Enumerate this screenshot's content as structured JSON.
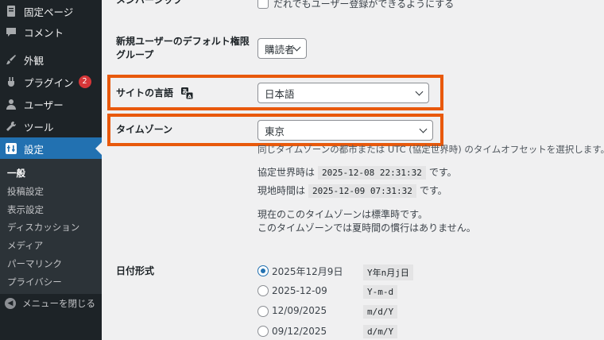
{
  "sidebar": {
    "items": [
      {
        "label": "固定ページ",
        "icon": "page-icon"
      },
      {
        "label": "コメント",
        "icon": "comment-icon"
      },
      {
        "label": "外観",
        "icon": "brush-icon"
      },
      {
        "label": "プラグイン",
        "icon": "plugin-icon",
        "badge": "2"
      },
      {
        "label": "ユーザー",
        "icon": "user-icon"
      },
      {
        "label": "ツール",
        "icon": "wrench-icon"
      },
      {
        "label": "設定",
        "icon": "settings-icon",
        "active": true
      }
    ],
    "submenu": [
      "一般",
      "投稿設定",
      "表示設定",
      "ディスカッション",
      "メディア",
      "パーマリンク",
      "プライバシー"
    ],
    "collapse_label": "メニューを閉じる"
  },
  "membership": {
    "label": "メンバーシップ",
    "checkbox_text": "だれでもユーザー登録ができるようにする"
  },
  "default_role": {
    "label": "新規ユーザーのデフォルト権限グループ",
    "value": "購読者"
  },
  "site_language": {
    "label": "サイトの言語",
    "value": "日本語"
  },
  "timezone": {
    "label": "タイムゾーン",
    "value": "東京",
    "description": "同じタイムゾーンの都市または UTC (協定世界時) のタイムオフセットを選択します。",
    "utc_label": "協定世界時は",
    "utc_value": "2025-12-08 22:31:32",
    "utc_suffix": "です。",
    "local_label": "現地時間は",
    "local_value": "2025-12-09 07:31:32",
    "local_suffix": "です。",
    "note1": "現在のこのタイムゾーンは標準時です。",
    "note2": "このタイムゾーンでは夏時間の慣行はありません。"
  },
  "date_format": {
    "label": "日付形式",
    "options": [
      {
        "display": "2025年12月9日",
        "format": "Y年n月j日",
        "checked": true
      },
      {
        "display": "2025-12-09",
        "format": "Y-m-d",
        "checked": false
      },
      {
        "display": "12/09/2025",
        "format": "m/d/Y",
        "checked": false
      },
      {
        "display": "09/12/2025",
        "format": "d/m/Y",
        "checked": false
      }
    ]
  },
  "colors": {
    "sidebar_bg": "#1d2327",
    "accent": "#2271b1",
    "highlight": "#e8590c",
    "badge": "#d63638"
  }
}
